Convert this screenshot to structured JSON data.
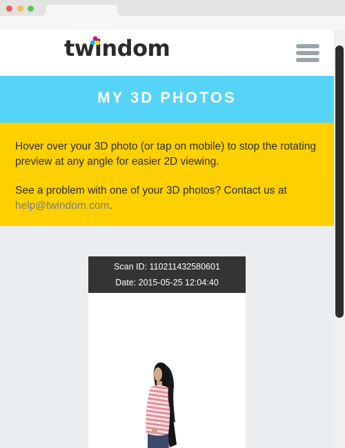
{
  "site": {
    "logo_text": "twindom",
    "colors": {
      "header_bg": "#ffffff",
      "title_bar": "#56d4f8",
      "info_bg": "#fdd000",
      "card_header": "#343434",
      "link": "#7d7d7d"
    }
  },
  "menu": {
    "icon": "hamburger-menu-icon"
  },
  "page": {
    "title": "MY 3D PHOTOS"
  },
  "info": {
    "paragraph1": "Hover over your 3D photo (or tap on mobile) to stop the rotating preview at any angle for easier 2D viewing.",
    "paragraph2_prefix": "See a problem with one of your 3D photos? Contact us at ",
    "email": "help@twindom.com",
    "paragraph2_suffix": "."
  },
  "scans": [
    {
      "scan_id_label": "Scan ID: 110211432580601",
      "date_label": "Date: 2015-05-25 12:04:40",
      "preview": "3d-figure-preview"
    }
  ]
}
